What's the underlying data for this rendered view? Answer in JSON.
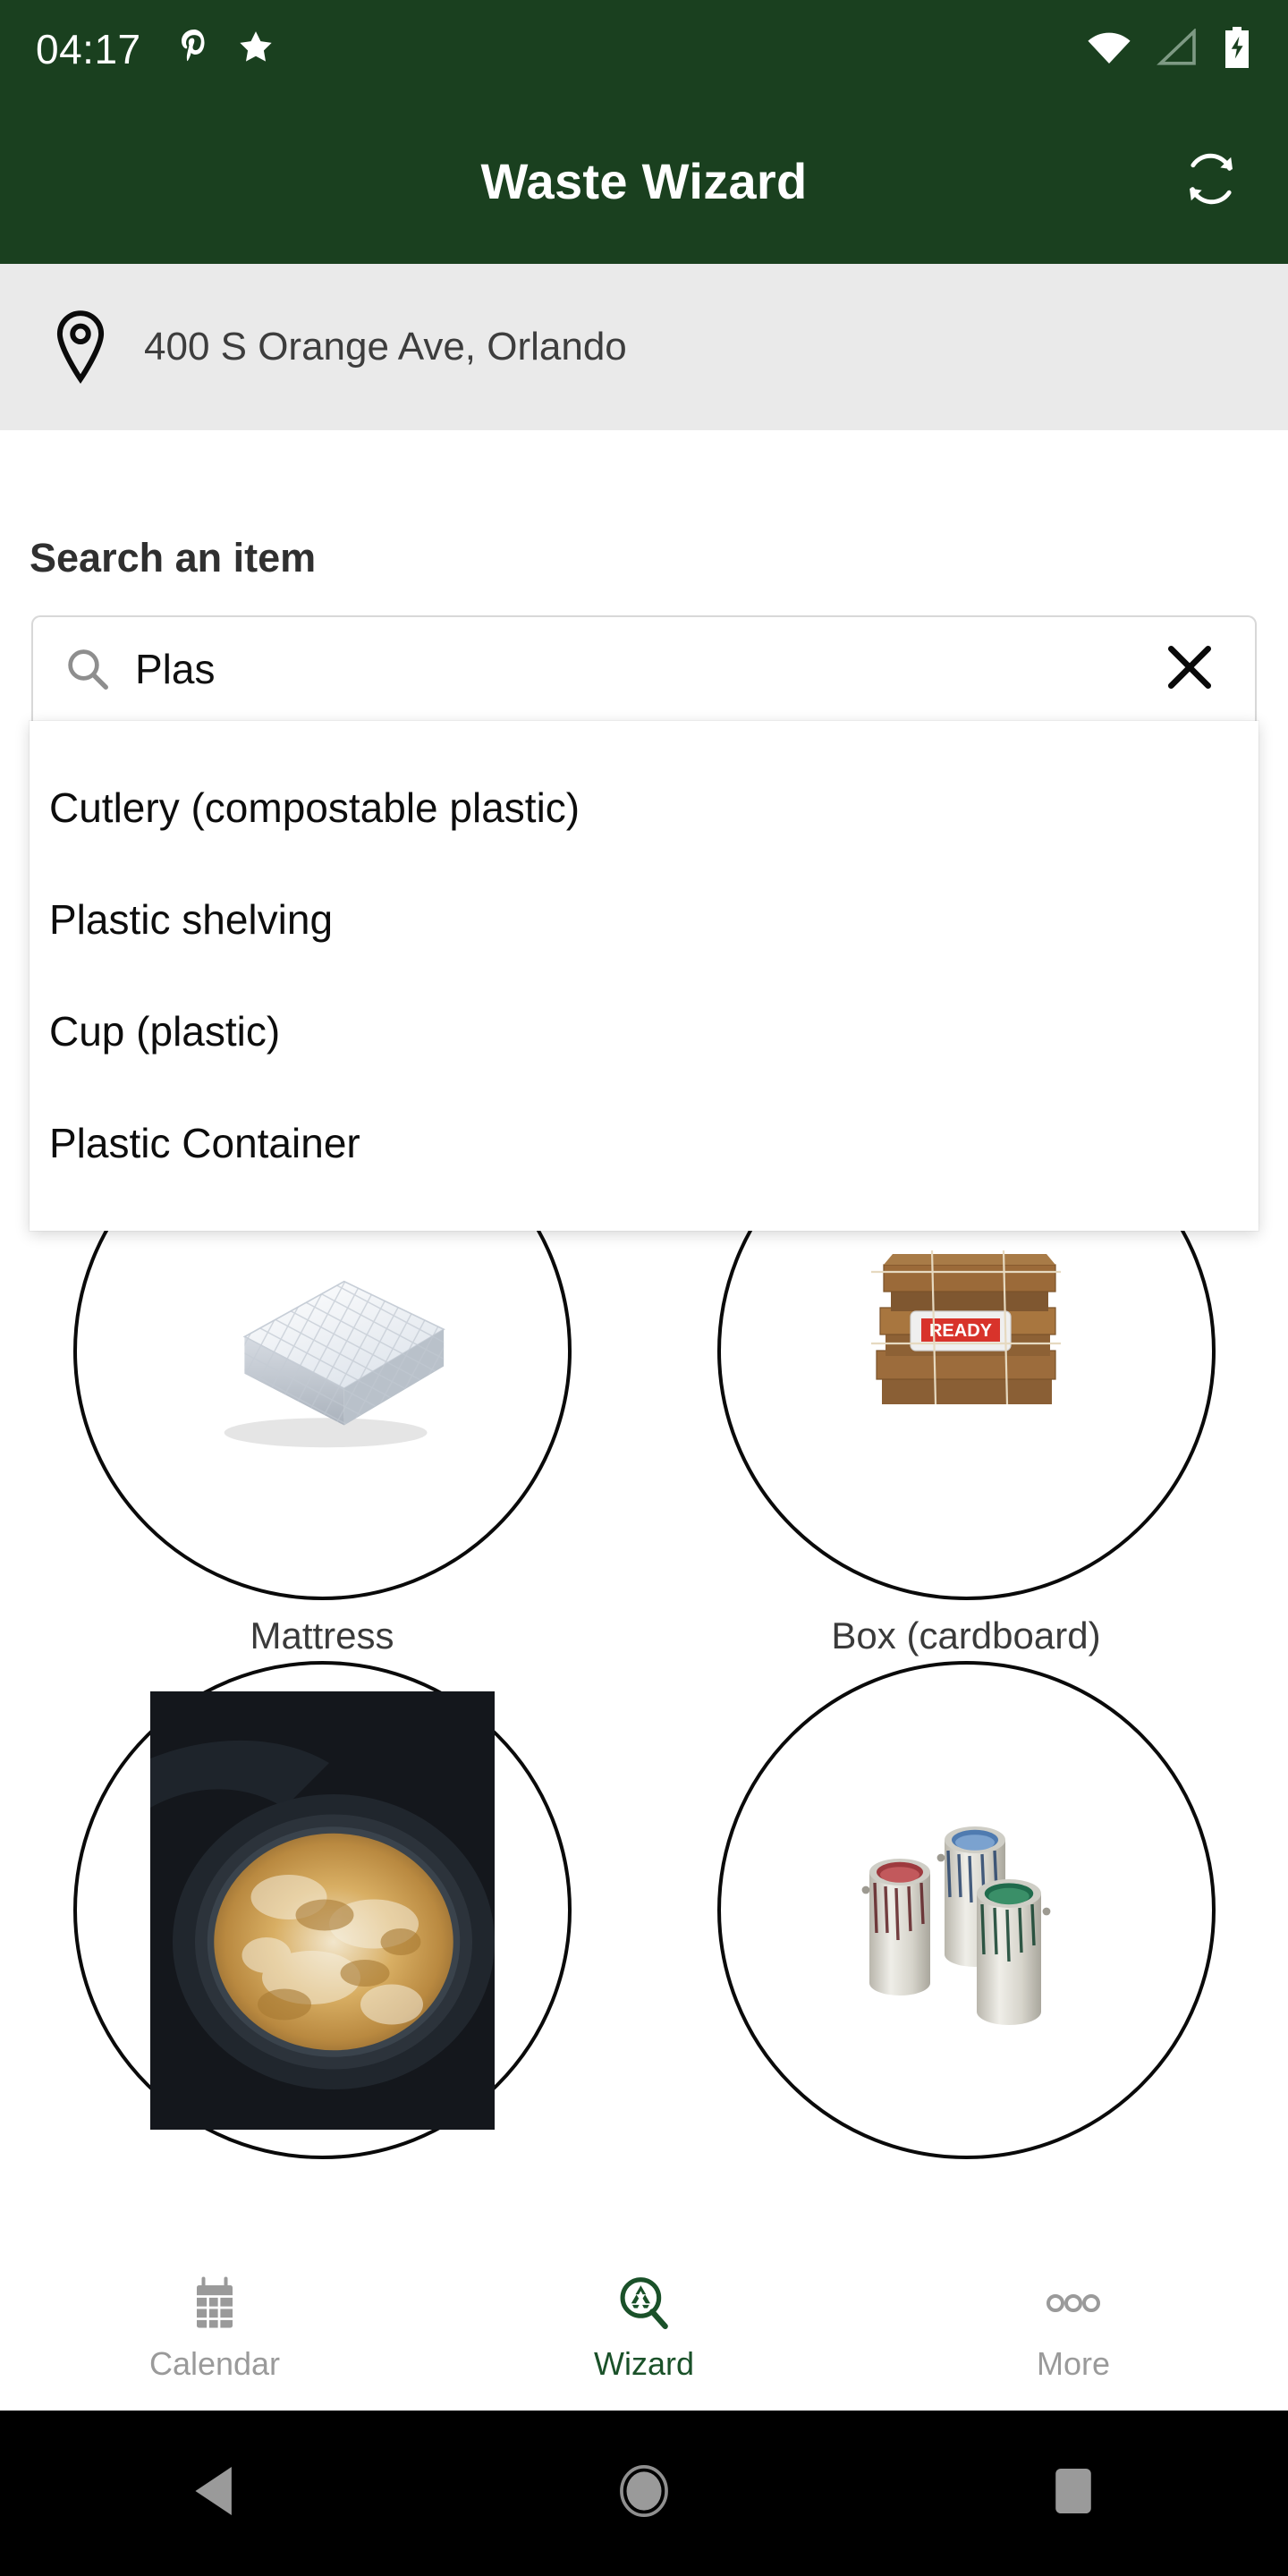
{
  "status_bar": {
    "clock": "04:17",
    "left_icons": [
      "pinterest-icon",
      "star-icon"
    ],
    "right_icons": [
      "wifi-icon",
      "cellular-signal-icon",
      "battery-charging-icon"
    ]
  },
  "app_bar": {
    "title": "Waste Wizard",
    "action_icon": "refresh-icon",
    "background_color": "#1a401f",
    "text_color": "#ffffff"
  },
  "location_bar": {
    "icon": "location-pin-icon",
    "address": "400 S Orange Ave, Orlando",
    "background_color": "#eaeaea"
  },
  "search": {
    "label": "Search an item",
    "icon": "search-icon",
    "value": "Plas",
    "placeholder": "Search an item",
    "clear_icon": "close-icon",
    "suggestions": [
      "Cutlery (compostable plastic)",
      "Plastic shelving",
      "Cup (plastic)",
      "Plastic Container"
    ]
  },
  "items": [
    {
      "label": "Mattress",
      "image": "mattress-thumbnail"
    },
    {
      "label": "Box (cardboard)",
      "image": "cardboard-box-thumbnail"
    },
    {
      "label": "",
      "image": "cooking-grease-pan-thumbnail"
    },
    {
      "label": "",
      "image": "paint-cans-thumbnail"
    }
  ],
  "bottom_nav": {
    "active_color": "#1a5129",
    "inactive_color": "#9a9a9a",
    "tabs": [
      {
        "label": "Calendar",
        "icon": "calendar-icon",
        "active": false
      },
      {
        "label": "Wizard",
        "icon": "recycle-search-icon",
        "active": true
      },
      {
        "label": "More",
        "icon": "more-dots-icon",
        "active": false
      }
    ]
  },
  "system_nav": {
    "buttons": [
      "back-icon",
      "home-icon",
      "recents-icon"
    ]
  }
}
